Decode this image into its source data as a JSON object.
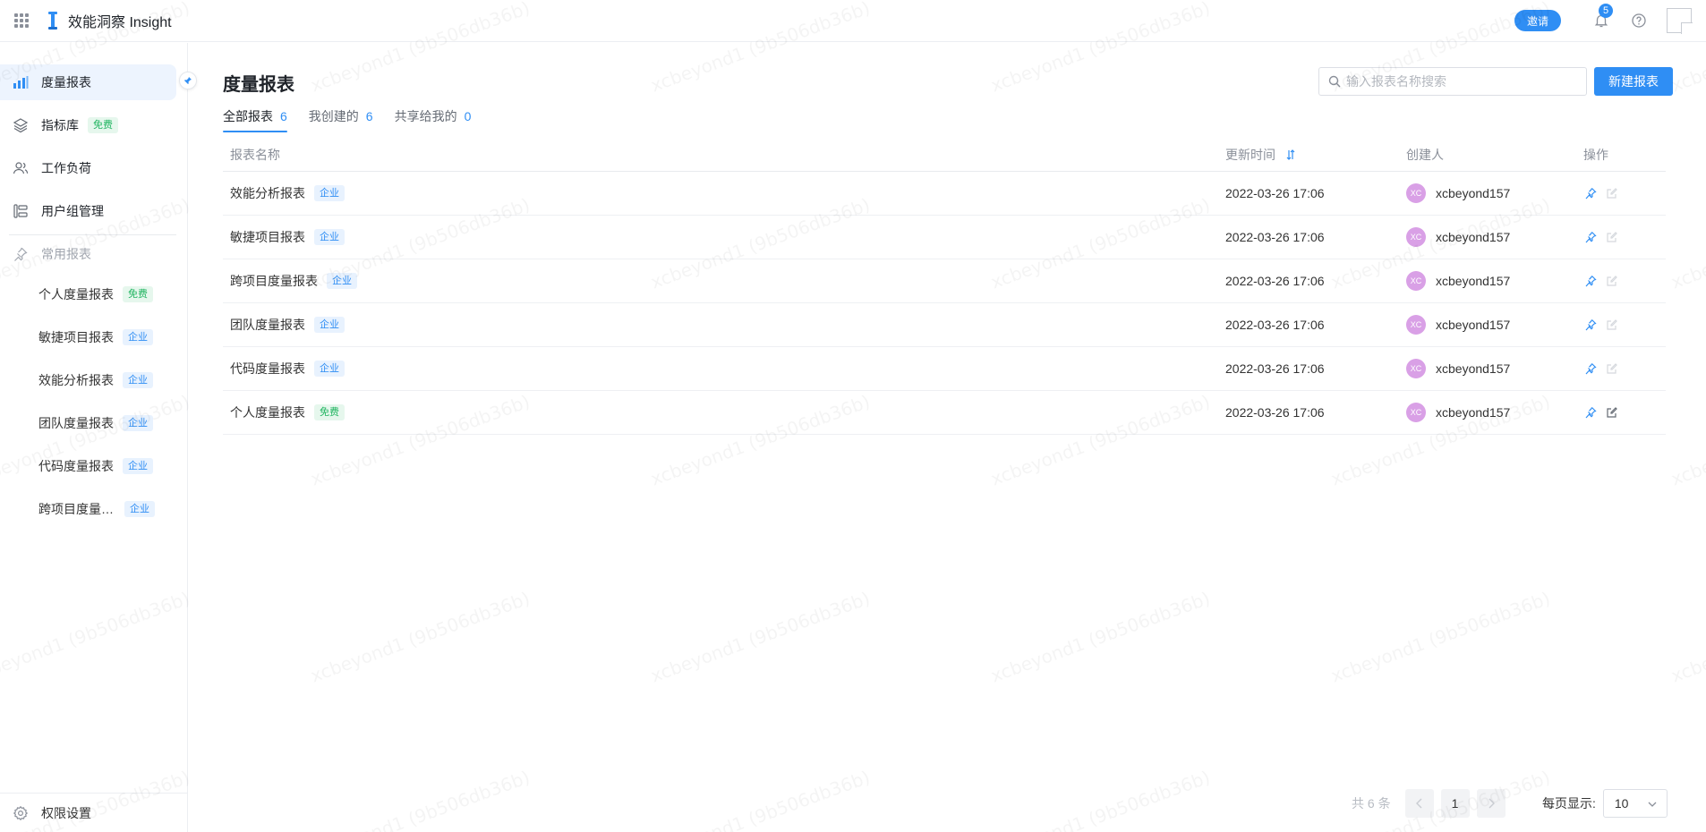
{
  "header": {
    "app_title": "效能洞察 Insight",
    "invite_label": "邀请",
    "notification_count": "5"
  },
  "sidebar": {
    "nav": [
      {
        "label": "度量报表",
        "icon": "bar-chart-icon",
        "active": true
      },
      {
        "label": "指标库",
        "icon": "layers-icon",
        "tag": "免费"
      },
      {
        "label": "工作负荷",
        "icon": "users-icon"
      },
      {
        "label": "用户组管理",
        "icon": "group-list-icon"
      }
    ],
    "section_title": "常用报表",
    "pinned": [
      {
        "label": "个人度量报表",
        "tag": "免费",
        "tag_type": "free"
      },
      {
        "label": "敏捷项目报表",
        "tag": "企业",
        "tag_type": "ent"
      },
      {
        "label": "效能分析报表",
        "tag": "企业",
        "tag_type": "ent"
      },
      {
        "label": "团队度量报表",
        "tag": "企业",
        "tag_type": "ent"
      },
      {
        "label": "代码度量报表",
        "tag": "企业",
        "tag_type": "ent"
      },
      {
        "label": "跨项目度量报表",
        "tag": "企业",
        "tag_type": "ent"
      }
    ],
    "footer_label": "权限设置"
  },
  "main": {
    "title": "度量报表",
    "search_placeholder": "输入报表名称搜索",
    "new_button": "新建报表",
    "tabs": [
      {
        "label": "全部报表",
        "count": "6",
        "active": true
      },
      {
        "label": "我创建的",
        "count": "6"
      },
      {
        "label": "共享给我的",
        "count": "0"
      }
    ],
    "columns": {
      "name": "报表名称",
      "updated": "更新时间",
      "creator": "创建人",
      "ops": "操作"
    },
    "rows": [
      {
        "name": "效能分析报表",
        "tag": "企业",
        "tag_type": "ent",
        "updated": "2022-03-26 17:06",
        "avatar": "XC",
        "creator": "xcbeyond157"
      },
      {
        "name": "敏捷项目报表",
        "tag": "企业",
        "tag_type": "ent",
        "updated": "2022-03-26 17:06",
        "avatar": "XC",
        "creator": "xcbeyond157"
      },
      {
        "name": "跨项目度量报表",
        "tag": "企业",
        "tag_type": "ent",
        "updated": "2022-03-26 17:06",
        "avatar": "XC",
        "creator": "xcbeyond157"
      },
      {
        "name": "团队度量报表",
        "tag": "企业",
        "tag_type": "ent",
        "updated": "2022-03-26 17:06",
        "avatar": "XC",
        "creator": "xcbeyond157"
      },
      {
        "name": "代码度量报表",
        "tag": "企业",
        "tag_type": "ent",
        "updated": "2022-03-26 17:06",
        "avatar": "XC",
        "creator": "xcbeyond157"
      },
      {
        "name": "个人度量报表",
        "tag": "免费",
        "tag_type": "free",
        "updated": "2022-03-26 17:06",
        "avatar": "XC",
        "creator": "xcbeyond157"
      }
    ],
    "pagination": {
      "total": "共 6 条",
      "current_page": "1",
      "per_page_label": "每页显示:",
      "per_page_value": "10"
    }
  },
  "watermark_text": "xcbeyond1 (9b506db36b)",
  "colors": {
    "accent": "#2f8ef4",
    "free_tag": "#21b561",
    "avatar": "#d9a0e6"
  }
}
